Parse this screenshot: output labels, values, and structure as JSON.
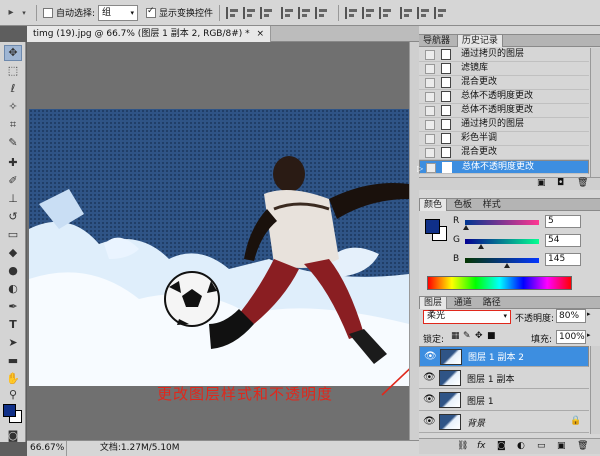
{
  "options_bar": {
    "auto_select_label": "自动选择:",
    "auto_select_value": "组",
    "show_transform_label": "显示变换控件"
  },
  "document": {
    "tab_title": "timg (19).jpg @ 66.7% (图层 1 副本 2, RGB/8#) *",
    "close_glyph": "×",
    "zoom": "66.67%",
    "doc_info": "文档:1.27M/5.10M"
  },
  "history_panel": {
    "tabs": [
      "导航器",
      "历史记录"
    ],
    "items": [
      {
        "label": "通过拷贝的图层"
      },
      {
        "label": "滤镜库"
      },
      {
        "label": "混合更改"
      },
      {
        "label": "总体不透明度更改"
      },
      {
        "label": "总体不透明度更改"
      },
      {
        "label": "通过拷贝的图层"
      },
      {
        "label": "彩色半调"
      },
      {
        "label": "混合更改"
      },
      {
        "label": "总体不透明度更改"
      }
    ],
    "selected_index": 8
  },
  "color_panel": {
    "tabs": [
      "颜色",
      "色板",
      "样式"
    ],
    "channels": [
      {
        "name": "R",
        "value": "5",
        "level": 0.02
      },
      {
        "name": "G",
        "value": "54",
        "level": 0.21
      },
      {
        "name": "B",
        "value": "145",
        "level": 0.57
      }
    ],
    "foreground_color": "#0f2f88",
    "background_color": "#ffffff"
  },
  "layers_panel": {
    "tabs": [
      "图层",
      "通道",
      "路径"
    ],
    "blend_mode": "柔光",
    "opacity_label": "不透明度:",
    "opacity_value": "80%",
    "lock_label": "锁定:",
    "fill_label": "填充:",
    "fill_value": "100%",
    "layers": [
      {
        "name": "图层 1 副本 2",
        "selected": true
      },
      {
        "name": "图层 1 副本",
        "selected": false
      },
      {
        "name": "图层 1",
        "selected": false
      },
      {
        "name": "背景",
        "selected": false,
        "locked": true
      }
    ]
  },
  "annotation": {
    "text": "更改图层样式和不透明度",
    "color": "#e0281c"
  },
  "colors": {
    "selection": "#3d8ee0",
    "panel_bg": "#d6d6d6"
  }
}
